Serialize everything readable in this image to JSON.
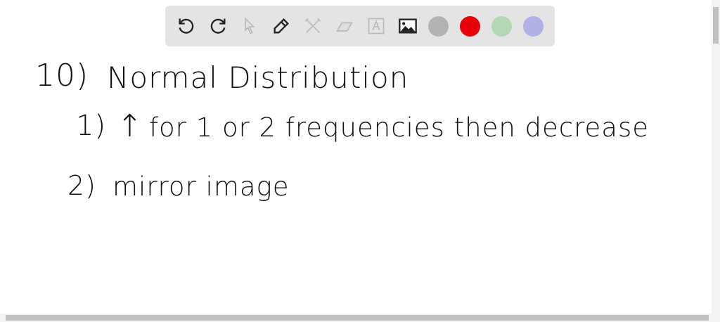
{
  "toolbar": {
    "tools": [
      "undo-icon",
      "redo-icon",
      "select-icon",
      "pen-icon",
      "tools-icon",
      "eraser-icon",
      "text-icon",
      "image-icon"
    ],
    "colors": [
      "#b3b3b3",
      "#e8000b",
      "#b4d8b4",
      "#b3b0e6"
    ]
  },
  "notes": {
    "line1_number": "10)",
    "line1_text": "Normal Distribution",
    "line2_number": "1)",
    "line2_arrow": "↑",
    "line2_text": "for 1 or 2 frequencies then decrease",
    "line3_number": "2)",
    "line3_text": "mirror image"
  }
}
